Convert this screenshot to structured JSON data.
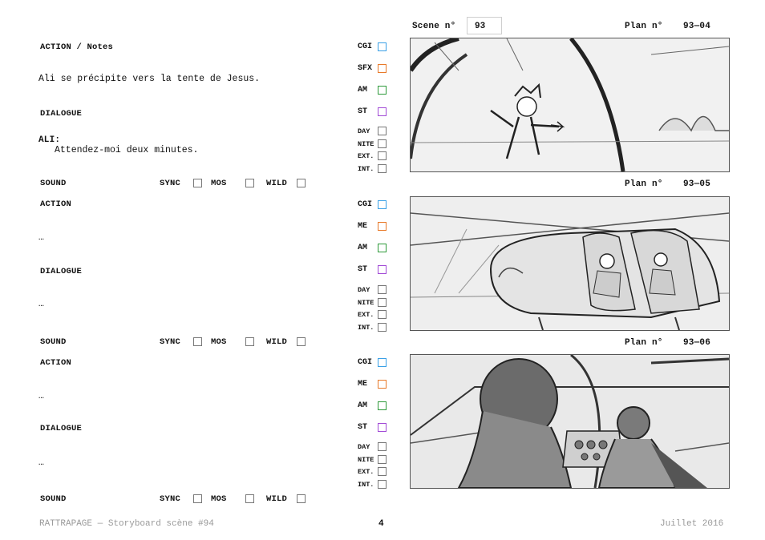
{
  "header": {
    "scene_label": "Scene n°",
    "scene_number": "93"
  },
  "blocks": [
    {
      "action_heading": "ACTION / Notes",
      "action_text": "Ali se précipite vers la tente de Jesus.",
      "dialogue_heading": "DIALOGUE",
      "speaker": "ALI:",
      "dialogue_text": "Attendez-moi deux minutes.",
      "sound": {
        "label": "SOUND",
        "sync": "SYNC",
        "mos": "MOS",
        "wild": "WILD"
      }
    },
    {
      "action_heading": "ACTION",
      "action_text": "…",
      "dialogue_heading": "DIALOGUE",
      "dialogue_text": "…",
      "sound": {
        "label": "SOUND",
        "sync": "SYNC",
        "mos": "MOS",
        "wild": "WILD"
      }
    },
    {
      "action_heading": "ACTION",
      "action_text": "…",
      "dialogue_heading": "DIALOGUE",
      "dialogue_text": "…",
      "sound": {
        "label": "SOUND",
        "sync": "SYNC",
        "mos": "MOS",
        "wild": "WILD"
      }
    }
  ],
  "shots": [
    {
      "plan_label": "Plan n°",
      "plan_number": "93—04",
      "checks": [
        "CGI",
        "SFX",
        "AM",
        "ST"
      ],
      "check_colors": [
        "#3aa0e6",
        "#e87a2a",
        "#2e9a3a",
        "#a24bd6"
      ],
      "small_checks": [
        "DAY",
        "NITE",
        "EXT.",
        "INT."
      ]
    },
    {
      "plan_label": "Plan n°",
      "plan_number": "93—05",
      "checks": [
        "CGI",
        "ME",
        "AM",
        "ST"
      ],
      "check_colors": [
        "#3aa0e6",
        "#e87a2a",
        "#2e9a3a",
        "#a24bd6"
      ],
      "small_checks": [
        "DAY",
        "NITE",
        "EXT.",
        "INT."
      ]
    },
    {
      "plan_label": "Plan n°",
      "plan_number": "93—06",
      "checks": [
        "CGI",
        "ME",
        "AM",
        "ST"
      ],
      "check_colors": [
        "#3aa0e6",
        "#e87a2a",
        "#2e9a3a",
        "#a24bd6"
      ],
      "small_checks": [
        "DAY",
        "NITE",
        "EXT.",
        "INT."
      ]
    }
  ],
  "footer": {
    "left": "RATTRAPAGE — Storyboard scène #94",
    "page": "4",
    "right": "Juillet 2016"
  }
}
